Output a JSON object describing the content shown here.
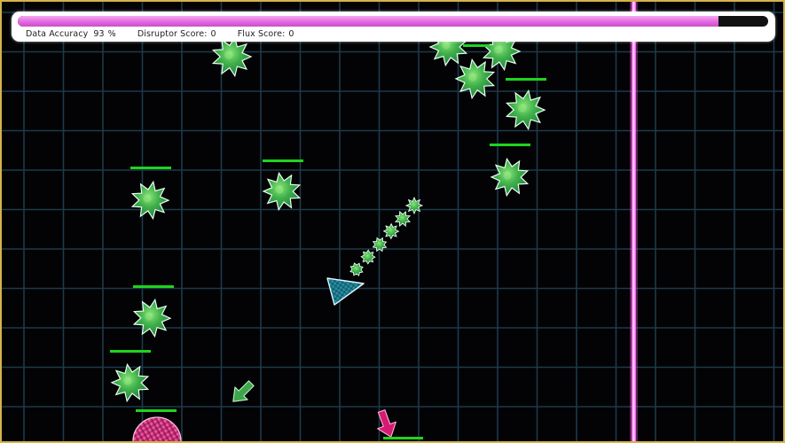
{
  "hud": {
    "accuracy_label": "Data Accuracy",
    "accuracy_value": "93",
    "accuracy_unit": "%",
    "disruptor_label": "Disruptor Score:",
    "disruptor_value": "0",
    "flux_label": "Flux Score:",
    "flux_value": "0",
    "progress_fraction": 0.934
  },
  "colors": {
    "background": "#030305",
    "grid_line": "#1d3a4a",
    "frame": "#d6b24a",
    "progress_fill": "#e36ae2",
    "enemy": "#3fb04a",
    "enemy_outline": "#e8fff0",
    "health_bar": "#1fd41f",
    "player": "#2aa7b8",
    "laser": "#ff5cf0",
    "hazard_arrow": "#d61a73",
    "pickup_arrow": "#3da64a",
    "orb": "#d6277d"
  },
  "icons": {
    "enemy": "spiky-virus-icon",
    "player": "triangle-ship-icon",
    "pickup": "arrow-down-left-icon",
    "hazard": "arrow-down-icon",
    "orb": "half-orb-icon"
  }
}
